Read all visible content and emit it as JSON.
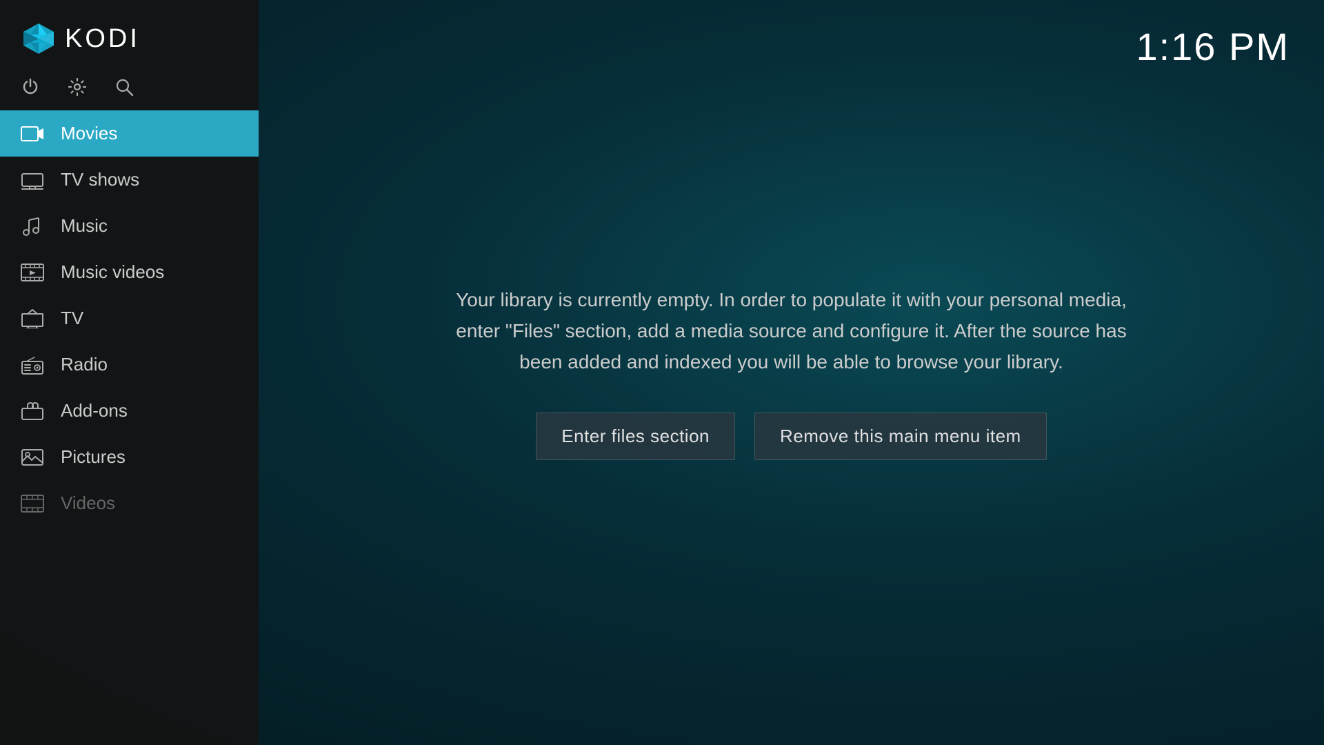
{
  "app": {
    "title": "KODI",
    "time": "1:16 PM"
  },
  "controls": {
    "power": "⏻",
    "settings": "⚙",
    "search": "🔍"
  },
  "nav": {
    "items": [
      {
        "id": "movies",
        "label": "Movies",
        "icon": "movies",
        "active": true,
        "dimmed": false
      },
      {
        "id": "tv-shows",
        "label": "TV shows",
        "icon": "tv",
        "active": false,
        "dimmed": false
      },
      {
        "id": "music",
        "label": "Music",
        "icon": "music",
        "active": false,
        "dimmed": false
      },
      {
        "id": "music-videos",
        "label": "Music videos",
        "icon": "music-videos",
        "active": false,
        "dimmed": false
      },
      {
        "id": "tv",
        "label": "TV",
        "icon": "antenna-tv",
        "active": false,
        "dimmed": false
      },
      {
        "id": "radio",
        "label": "Radio",
        "icon": "radio",
        "active": false,
        "dimmed": false
      },
      {
        "id": "add-ons",
        "label": "Add-ons",
        "icon": "addons",
        "active": false,
        "dimmed": false
      },
      {
        "id": "pictures",
        "label": "Pictures",
        "icon": "pictures",
        "active": false,
        "dimmed": false
      },
      {
        "id": "videos",
        "label": "Videos",
        "icon": "videos",
        "active": false,
        "dimmed": true
      }
    ]
  },
  "main": {
    "empty_message": "Your library is currently empty. In order to populate it with your personal media, enter \"Files\" section, add a media source and configure it. After the source has been added and indexed you will be able to browse your library.",
    "enter_files_label": "Enter files section",
    "remove_item_label": "Remove this main menu item"
  }
}
